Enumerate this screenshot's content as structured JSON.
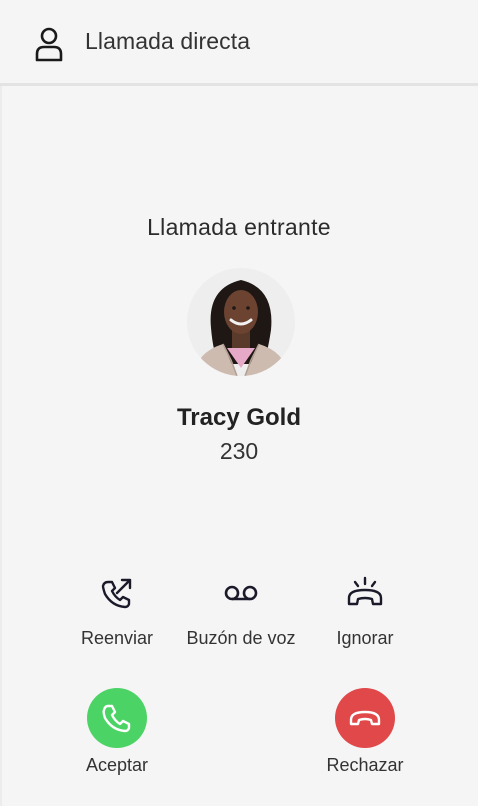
{
  "header": {
    "title": "Llamada directa",
    "icon": "user-icon"
  },
  "call": {
    "status": "Llamada entrante",
    "caller_name": "Tracy Gold",
    "caller_ext": "230"
  },
  "actions": [
    {
      "id": "forward",
      "label": "Reenviar",
      "icon": "phone-forward-icon"
    },
    {
      "id": "voicemail",
      "label": "Buzón de voz",
      "icon": "voicemail-icon"
    },
    {
      "id": "ignore",
      "label": "Ignorar",
      "icon": "ring-off-icon"
    }
  ],
  "buttons": {
    "accept": {
      "label": "Aceptar",
      "icon": "phone-icon",
      "color": "#4cd365"
    },
    "reject": {
      "label": "Rechazar",
      "icon": "hang-up-icon",
      "color": "#e0484a"
    }
  },
  "colors": {
    "background": "#f5f5f5",
    "icon_stroke": "#1a1a2a"
  }
}
